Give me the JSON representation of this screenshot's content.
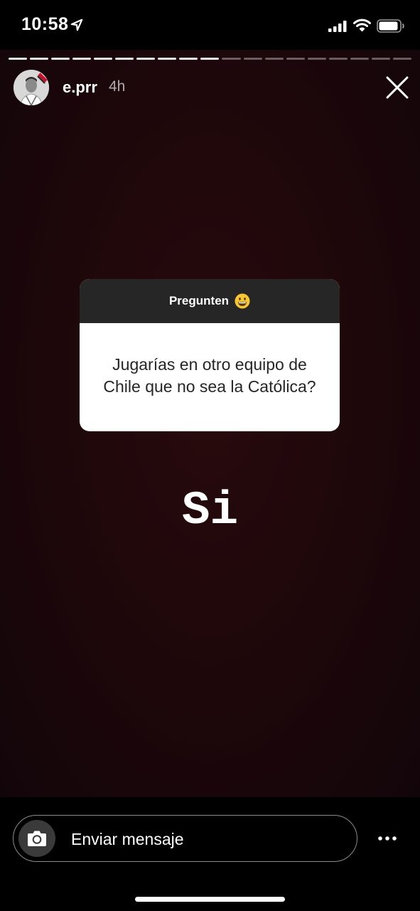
{
  "status_bar": {
    "time": "10:58",
    "icons": [
      "location-arrow-icon",
      "cellular-signal-icon",
      "wifi-icon",
      "battery-icon"
    ]
  },
  "story": {
    "progress": {
      "segments": 19,
      "viewed": 10
    },
    "user": {
      "username": "e.prr",
      "time_ago": "4h"
    },
    "question_sticker": {
      "header": "Pregunten",
      "header_emoji": "grinning-face-emoji",
      "question": "Jugarías en otro equipo de Chile que no sea la Católica?"
    },
    "answer_text": "Si",
    "colors": {
      "background": "#1d070a",
      "sticker_header": "#262626",
      "sticker_body": "#ffffff"
    }
  },
  "composer": {
    "placeholder": "Enviar mensaje",
    "camera_icon": "camera-icon",
    "more_icon": "more-options-icon"
  }
}
